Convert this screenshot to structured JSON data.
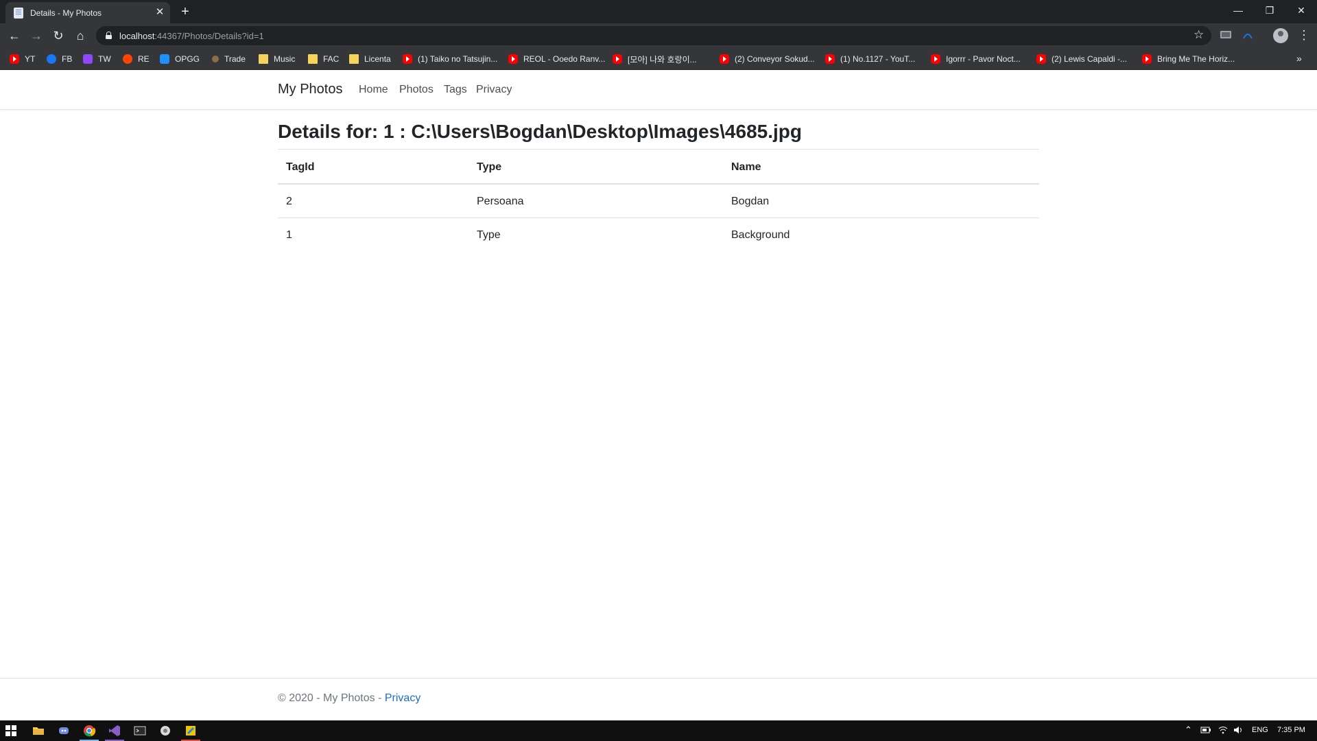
{
  "browser": {
    "tab_title": "Details - My Photos",
    "tab_close": "✕",
    "new_tab": "+",
    "url_host": "localhost",
    "url_rest": ":44367/Photos/Details?id=1",
    "window_controls": {
      "minimize": "—",
      "restore": "❐",
      "close": "✕"
    },
    "nav_glyphs": {
      "back": "←",
      "forward": "→",
      "reload": "↻",
      "home": "⌂",
      "star": "☆",
      "menu": "⋮",
      "more_bookmarks": "»"
    }
  },
  "bookmarks": [
    {
      "label": "YT",
      "icon": "youtube-icon"
    },
    {
      "label": "FB",
      "icon": "facebook-icon"
    },
    {
      "label": "TW",
      "icon": "twitch-icon"
    },
    {
      "label": "RE",
      "icon": "reddit-icon"
    },
    {
      "label": "OPGG",
      "icon": "opgg-icon"
    },
    {
      "label": "Trade",
      "icon": "trade-icon"
    },
    {
      "label": "Music",
      "icon": "folder-icon"
    },
    {
      "label": "FAC",
      "icon": "folder-icon"
    },
    {
      "label": "Licenta",
      "icon": "folder-icon"
    },
    {
      "label": "(1) Taiko no Tatsujin...",
      "icon": "youtube-icon"
    },
    {
      "label": "REOL - Ooedo Ranv...",
      "icon": "youtube-icon"
    },
    {
      "label": "[모아] 나와 호랑이...",
      "icon": "youtube-icon"
    },
    {
      "label": "(2) Conveyor Sokud...",
      "icon": "youtube-icon"
    },
    {
      "label": "(1) No.1127 - YouT...",
      "icon": "youtube-icon"
    },
    {
      "label": "Igorrr - Pavor Noct...",
      "icon": "youtube-icon"
    },
    {
      "label": "(2) Lewis Capaldi -...",
      "icon": "youtube-icon"
    },
    {
      "label": "Bring Me The Horiz...",
      "icon": "youtube-icon"
    }
  ],
  "navbar": {
    "brand": "My Photos",
    "links": [
      "Home",
      "Photos",
      "Tags",
      "Privacy"
    ]
  },
  "main": {
    "heading": "Details for: 1 : C:\\Users\\Bogdan\\Desktop\\Images\\4685.jpg",
    "table": {
      "headers": [
        "TagId",
        "Type",
        "Name"
      ],
      "rows": [
        [
          "2",
          "Persoana",
          "Bogdan"
        ],
        [
          "1",
          "Type",
          "Background"
        ]
      ]
    }
  },
  "footer": {
    "text": "© 2020 - My Photos - ",
    "link": "Privacy"
  },
  "taskbar": {
    "language": "ENG",
    "time": "7:35 PM"
  },
  "colors": {
    "link": "#1b6ec2",
    "chrome_dark": "#202124",
    "chrome_toolbar": "#35363a"
  }
}
